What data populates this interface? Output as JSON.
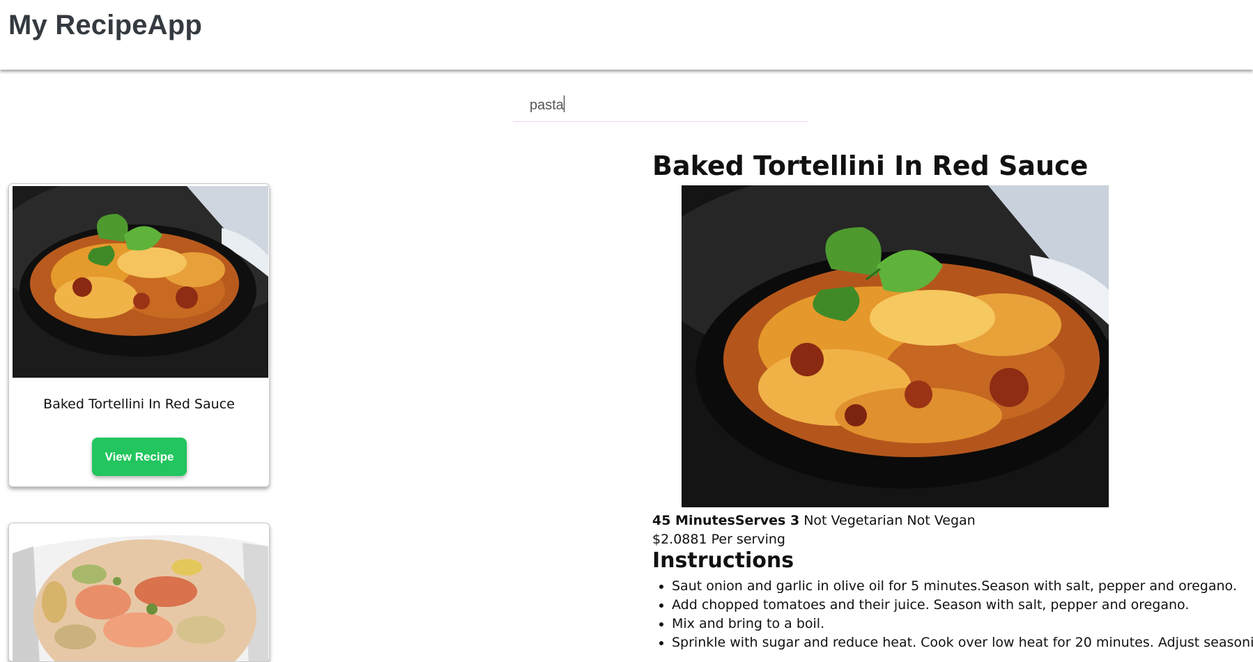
{
  "header": {
    "title": "My RecipeApp"
  },
  "search": {
    "value": "pasta"
  },
  "results": [
    {
      "title": "Baked Tortellini In Red Sauce",
      "button_label": "View Recipe",
      "image": "baked-tortellini-photo"
    },
    {
      "title": "",
      "button_label": "",
      "image": "pasta-salad-photo"
    }
  ],
  "detail": {
    "title": "Baked Tortellini In Red Sauce",
    "image": "baked-tortellini-photo",
    "time": "45 Minutes",
    "serves": "Serves 3",
    "vegetarian": " Not Vegetarian",
    "vegan": " Not Vegan",
    "price": "$2.0881 Per serving",
    "instructions_heading": "Instructions",
    "instructions": [
      "Saut onion and garlic in olive oil for 5 minutes.Season with salt, pepper and oregano.",
      "Add chopped tomatoes and their juice. Season with salt, pepper and oregano.",
      "Mix and bring to a boil.",
      "Sprinkle with sugar and reduce heat. Cook over low heat for 20 minutes. Adjust seasoning.Me"
    ]
  },
  "colors": {
    "button_bg": "#22c55e",
    "header_text": "#343a40",
    "search_underline": "#f1d2f3"
  }
}
